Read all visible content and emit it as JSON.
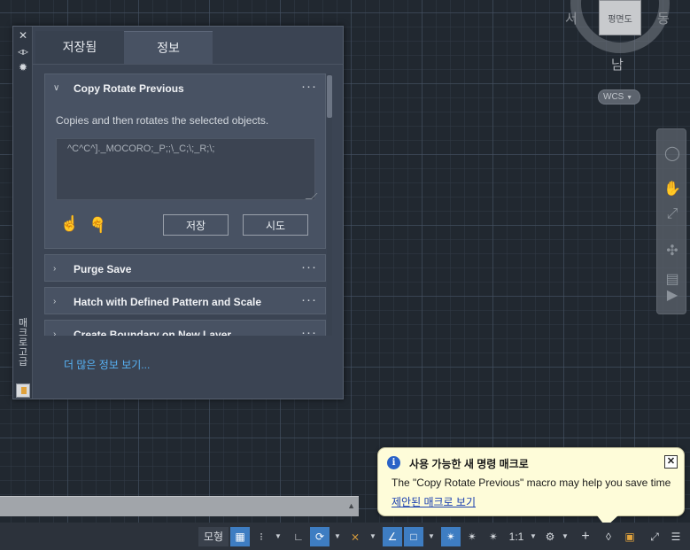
{
  "viewcube": {
    "west": "서",
    "east": "동",
    "south": "남",
    "face": "평면도",
    "ucs": "WCS"
  },
  "palette": {
    "strip_title": "매크로 고급",
    "tabs": {
      "saved": "저장됨",
      "info": "정보"
    },
    "expanded_macro": {
      "title": "Copy Rotate Previous",
      "description": "Copies and then rotates the selected objects.",
      "macro_text": "^C^C^]._MOCORO;_P;;\\_C;\\;_R;\\;",
      "save_label": "저장",
      "try_label": "시도"
    },
    "macros": [
      {
        "title": "Purge Save"
      },
      {
        "title": "Hatch with Defined Pattern and Scale"
      },
      {
        "title": "Create Boundary on New Layer"
      }
    ],
    "more_link": "더 많은 정보 보기..."
  },
  "statusbar": {
    "model_label": "모형",
    "scale_label": "1:1"
  },
  "notification": {
    "title": "사용 가능한 새 명령 매크로",
    "message": "The \"Copy Rotate Previous\" macro may help you save time",
    "link": "제안된 매크로 보기"
  },
  "colors": {
    "canvas": "#212830",
    "palette_bg": "#3b4453",
    "accent": "#3e7dc2",
    "link": "#57b2f5",
    "bubble": "#fefcd9"
  }
}
